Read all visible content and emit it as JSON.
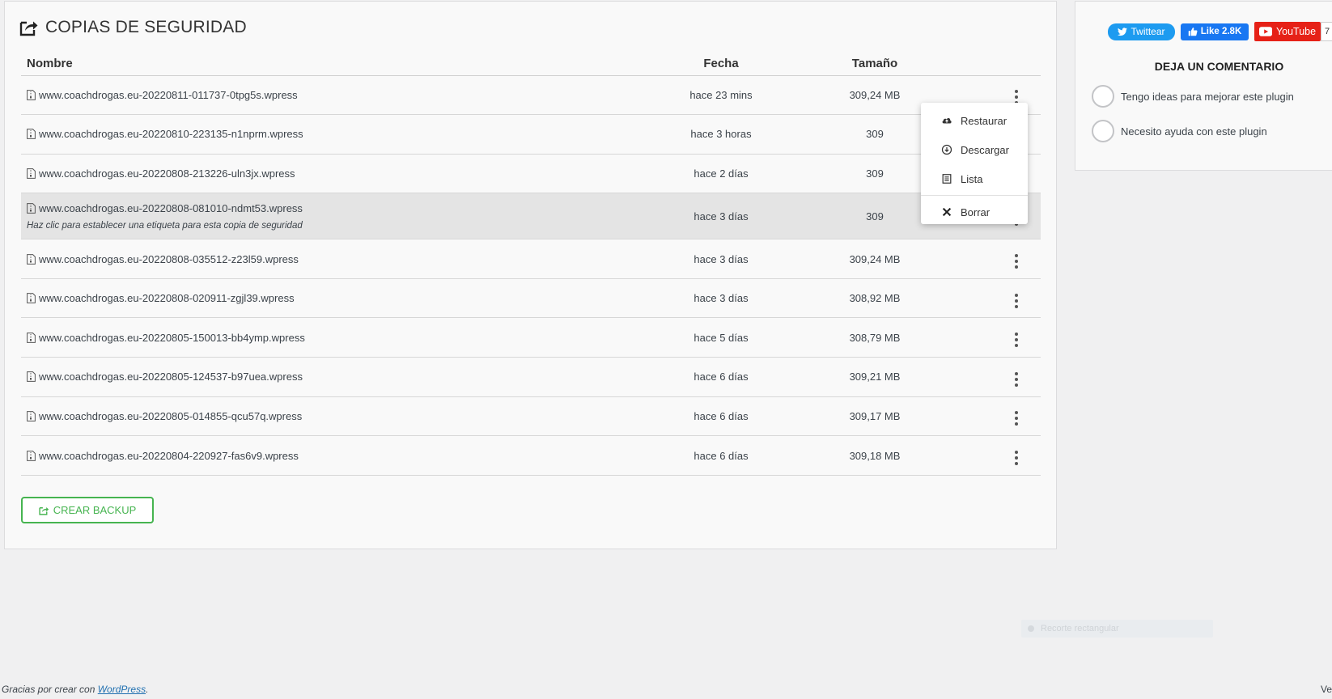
{
  "panel": {
    "title": "COPIAS DE SEGURIDAD",
    "columns": {
      "name": "Nombre",
      "date": "Fecha",
      "size": "Tamaño"
    },
    "rows": [
      {
        "name": "www.coachdrogas.eu-20220811-011737-0tpg5s.wpress",
        "date": "hace 23 mins",
        "size": "309,24 MB"
      },
      {
        "name": "www.coachdrogas.eu-20220810-223135-n1nprm.wpress",
        "date": "hace 3 horas",
        "size": "309"
      },
      {
        "name": "www.coachdrogas.eu-20220808-213226-uln3jx.wpress",
        "date": "hace 2 días",
        "size": "309"
      },
      {
        "name": "www.coachdrogas.eu-20220808-081010-ndmt53.wpress",
        "date": "hace 3 días",
        "size": "309",
        "hint": "Haz clic para establecer una etiqueta para esta copia de seguridad"
      },
      {
        "name": "www.coachdrogas.eu-20220808-035512-z23l59.wpress",
        "date": "hace 3 días",
        "size": "309,24 MB"
      },
      {
        "name": "www.coachdrogas.eu-20220808-020911-zgjl39.wpress",
        "date": "hace 3 días",
        "size": "308,92 MB"
      },
      {
        "name": "www.coachdrogas.eu-20220805-150013-bb4ymp.wpress",
        "date": "hace 5 días",
        "size": "308,79 MB"
      },
      {
        "name": "www.coachdrogas.eu-20220805-124537-b97uea.wpress",
        "date": "hace 6 días",
        "size": "309,21 MB"
      },
      {
        "name": "www.coachdrogas.eu-20220805-014855-qcu57q.wpress",
        "date": "hace 6 días",
        "size": "309,17 MB"
      },
      {
        "name": "www.coachdrogas.eu-20220804-220927-fas6v9.wpress",
        "date": "hace 6 días",
        "size": "309,18 MB"
      }
    ],
    "create_button": "CREAR BACKUP"
  },
  "menu": {
    "restore": "Restaurar",
    "download": "Descargar",
    "list": "Lista",
    "delete": "Borrar"
  },
  "side": {
    "twitter": "Twittear",
    "facebook": "Like 2.8K",
    "youtube": "YouTube",
    "youtube_count": "7",
    "comment_title": "DEJA UN COMENTARIO",
    "option1": "Tengo ideas para mejorar este plugin",
    "option2": "Necesito ayuda con este plugin"
  },
  "overlay": {
    "text": "Recorte rectangular"
  },
  "footer": {
    "prefix": "Gracias por crear con ",
    "link": "WordPress",
    "suffix": ".",
    "right": "Ve"
  },
  "colors": {
    "accent_green": "#46b450",
    "twitter": "#1d9bf0",
    "facebook": "#1877f2",
    "youtube": "#e62117",
    "link": "#2271b1"
  }
}
